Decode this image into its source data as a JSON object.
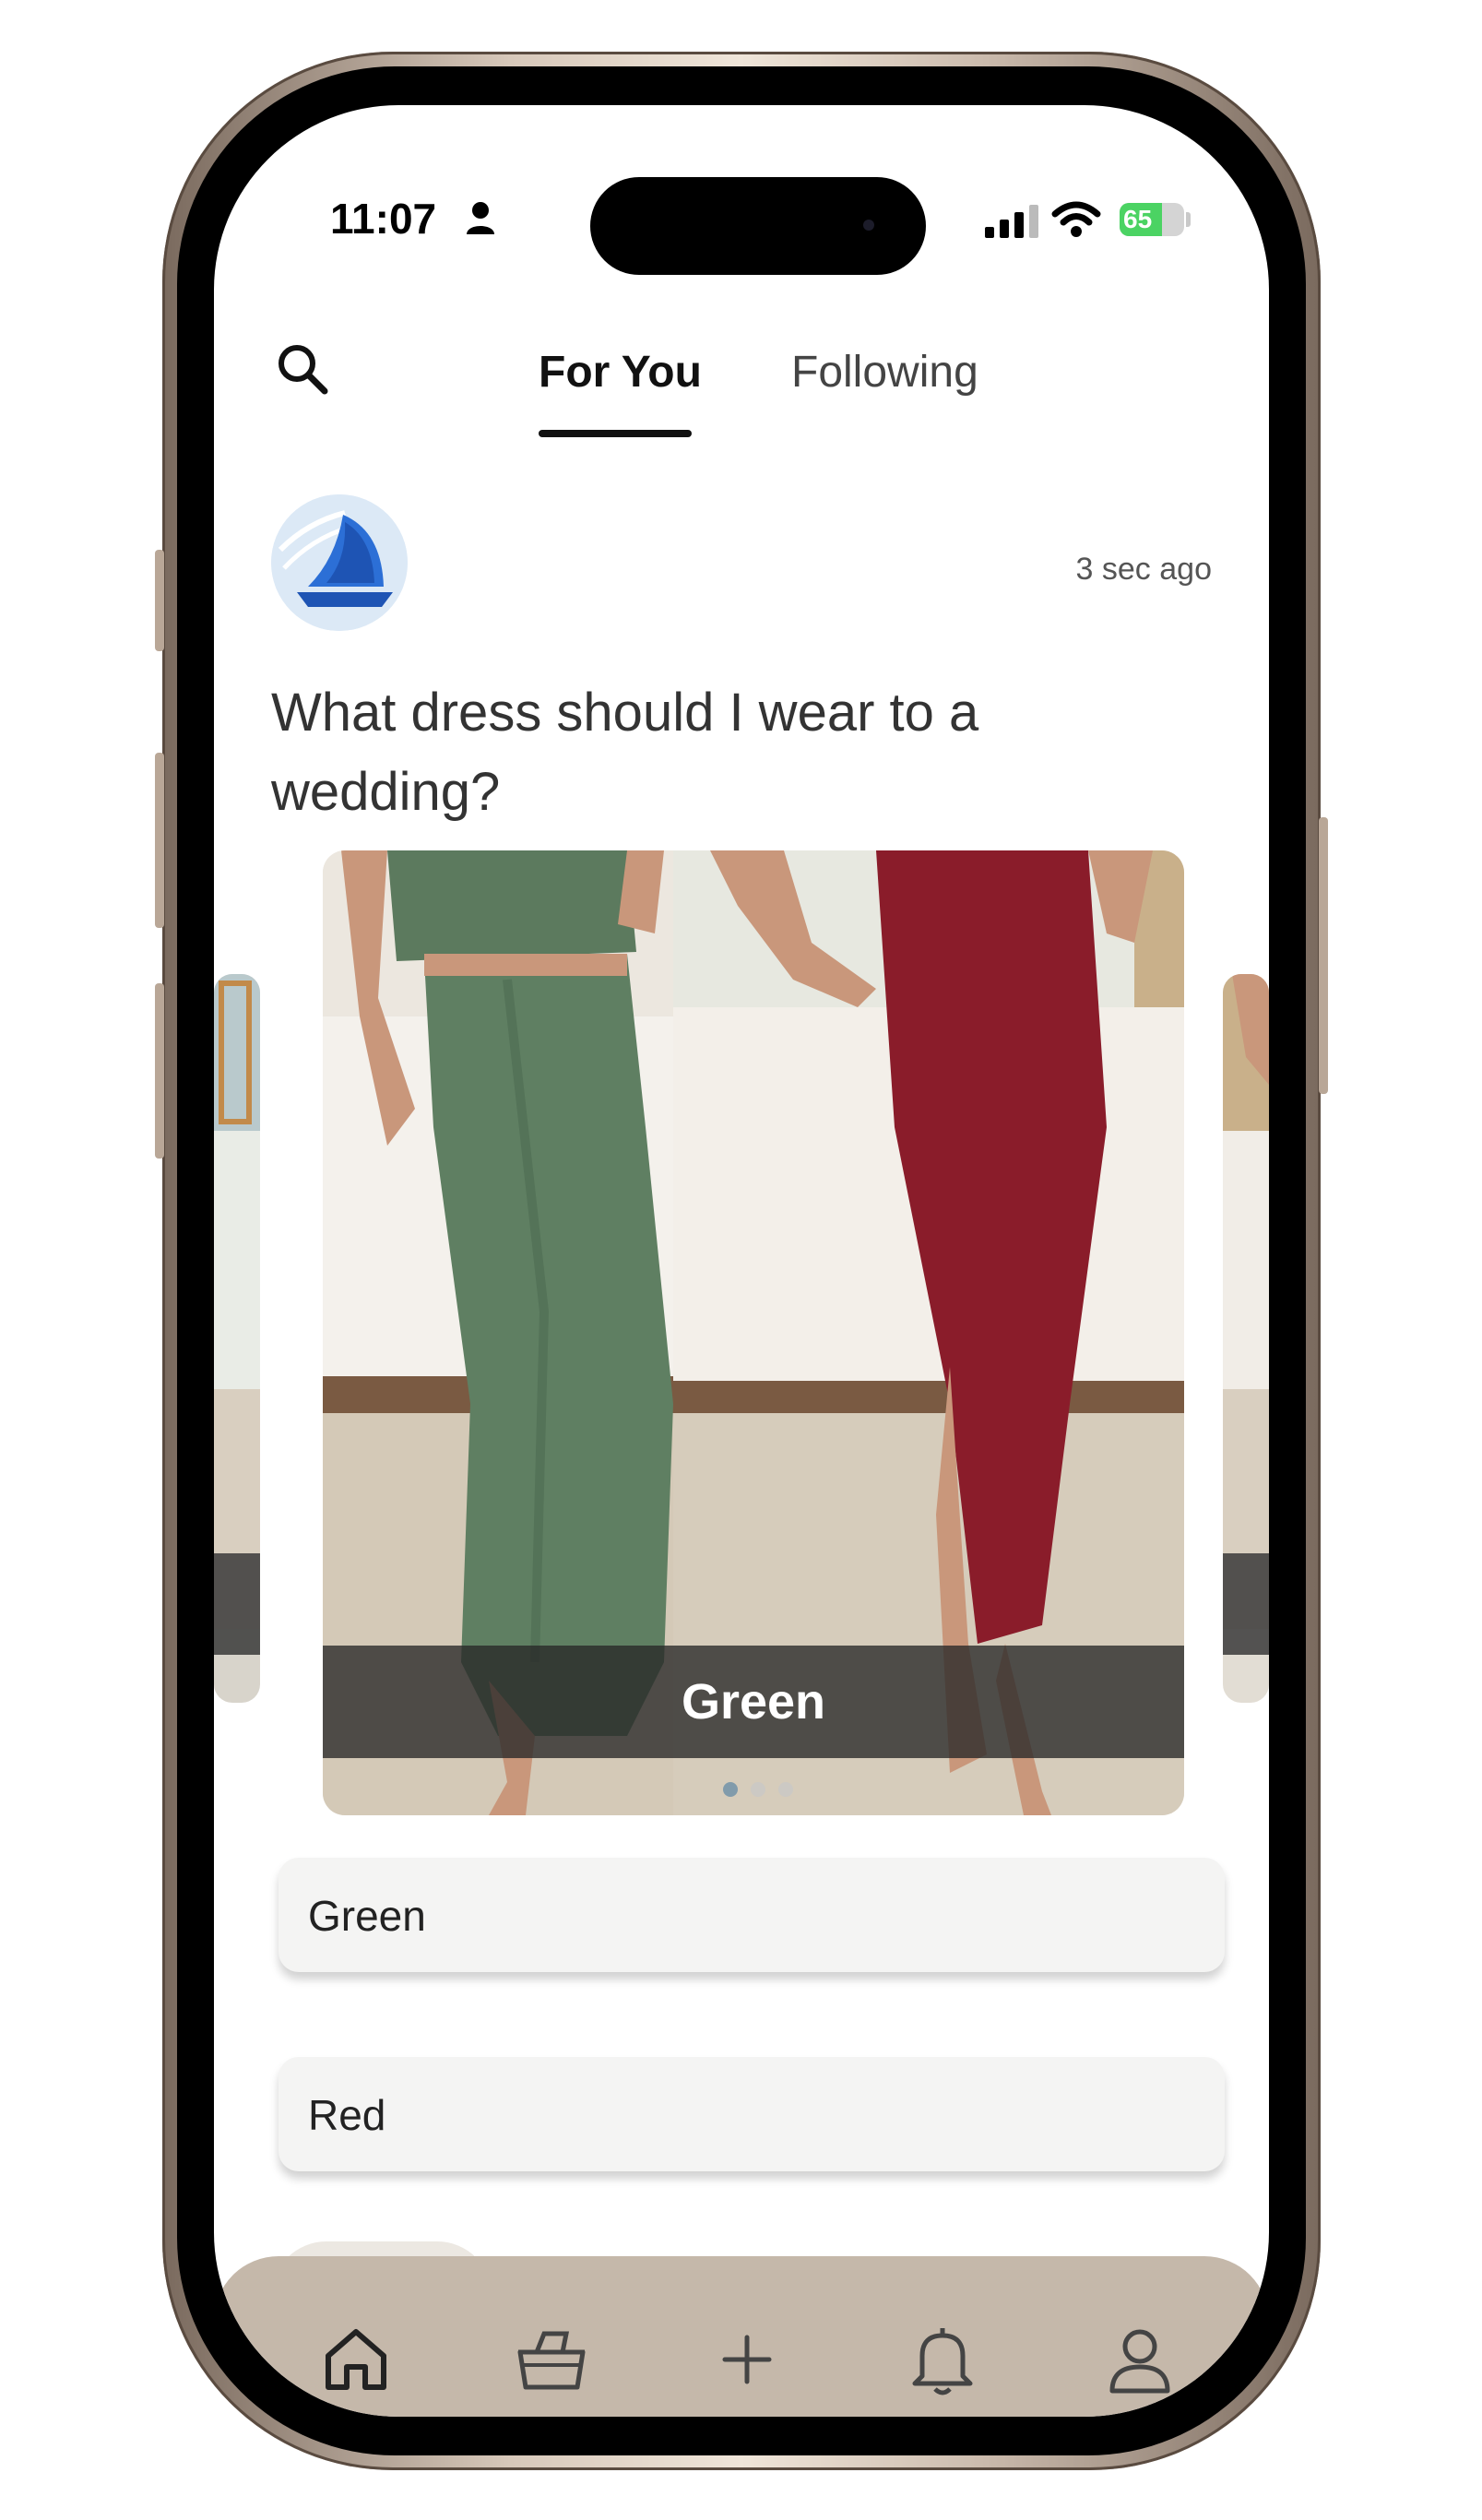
{
  "status_bar": {
    "time": "11:07",
    "battery_percent": "65",
    "battery_level": 0.65
  },
  "header": {
    "tabs": [
      {
        "label": "For You",
        "active": true
      },
      {
        "label": "Following",
        "active": false
      }
    ]
  },
  "post": {
    "timestamp": "3 sec ago",
    "question": "What dress should I wear to a wedding?",
    "carousel": {
      "caption": "Green",
      "page_count": 3,
      "active_index": 0
    },
    "options": [
      {
        "label": "Green"
      },
      {
        "label": "Red"
      }
    ]
  },
  "bottom_nav": {
    "items": [
      {
        "icon": "home-icon",
        "active": true
      },
      {
        "icon": "basket-icon",
        "active": false
      },
      {
        "icon": "plus-icon",
        "active": false
      },
      {
        "icon": "bell-icon",
        "active": false
      },
      {
        "icon": "profile-icon",
        "active": false
      }
    ]
  },
  "colors": {
    "nav_background": "#c5b8aa",
    "battery_green": "#4bd363",
    "green_dress": "#5f7f62",
    "red_dress": "#8a1c2a"
  }
}
